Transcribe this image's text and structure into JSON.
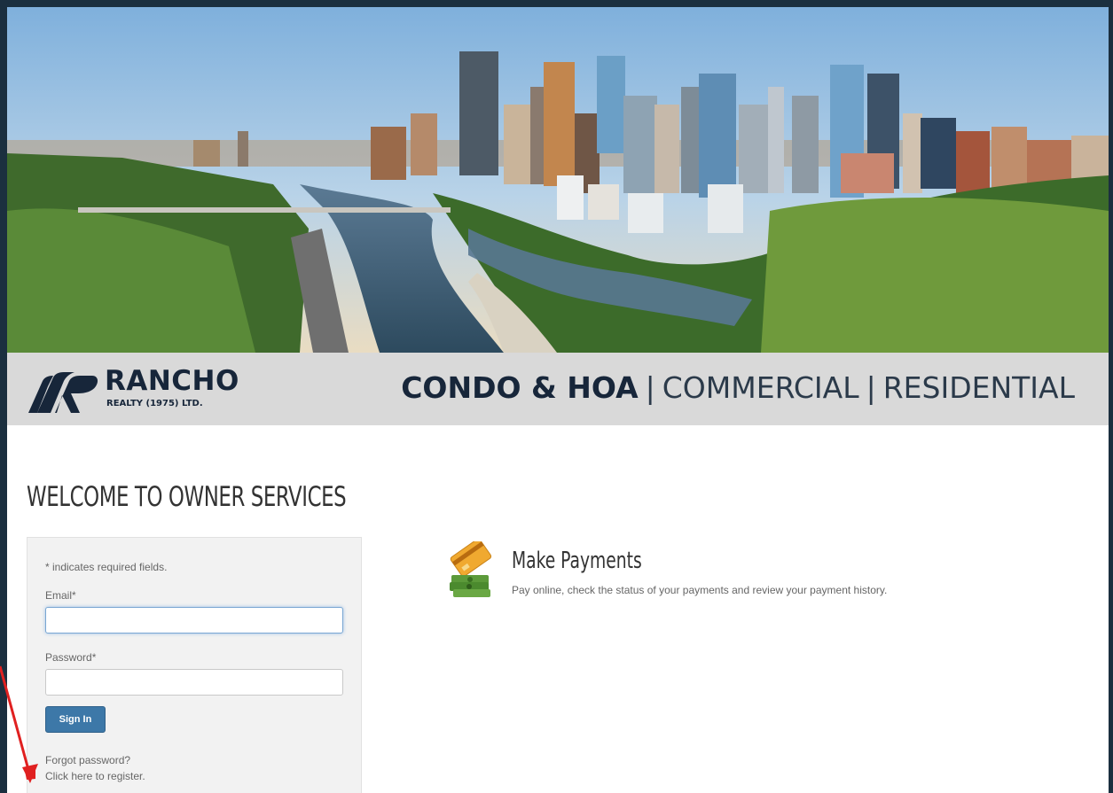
{
  "brand": {
    "name": "RANCHO",
    "sub": "REALTY (1975) LTD."
  },
  "tagline": {
    "strong": "CONDO & HOA",
    "sep1": "|",
    "item2": "COMMERCIAL",
    "sep2": "|",
    "item3": "RESIDENTIAL"
  },
  "welcome": "WELCOME TO OWNER SERVICES",
  "login": {
    "required_note": "* indicates required fields.",
    "email_label": "Email*",
    "email_value": "",
    "password_label": "Password*",
    "password_value": "",
    "signin_label": "Sign In",
    "forgot_link": "Forgot password?",
    "register_link": "Click here to register."
  },
  "payments": {
    "title": "Make Payments",
    "description": "Pay online, check the status of your payments and review your payment history.",
    "icon": "card-and-cash-icon"
  },
  "colors": {
    "frame": "#1b2f3f",
    "brand_bar": "#d9d9d9",
    "button": "#3d78a8",
    "annotation_arrow": "#e02020"
  }
}
